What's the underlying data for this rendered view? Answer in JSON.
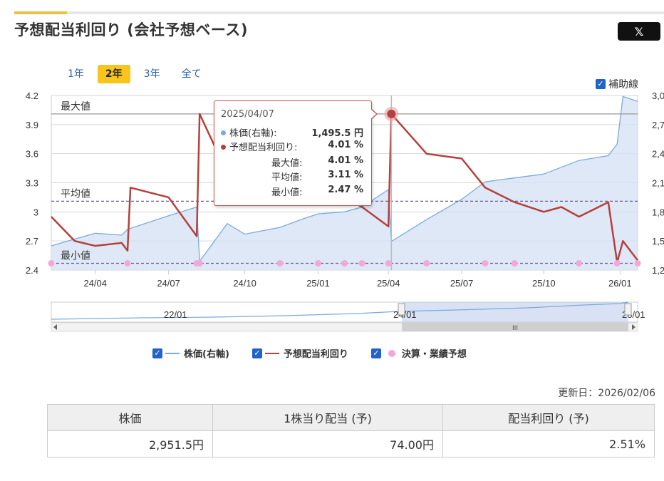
{
  "title": "予想配当利回り (会社予想ベース)",
  "share_button": {
    "label": "𝕏"
  },
  "ranges": [
    {
      "label": "1年",
      "active": false
    },
    {
      "label": "2年",
      "active": true
    },
    {
      "label": "3年",
      "active": false
    },
    {
      "label": "全て",
      "active": false
    }
  ],
  "aux_line": {
    "label": "補助線",
    "checked": true
  },
  "tooltip": {
    "date": "2025/04/07",
    "rows": [
      {
        "label": "株価(右軸):",
        "value": "1,495.5 円"
      },
      {
        "label": "予想配当利回り:",
        "value": "4.01 %"
      },
      {
        "label": "最大値:",
        "value": "4.01 %"
      },
      {
        "label": "平均値:",
        "value": "3.11 %"
      },
      {
        "label": "最小値:",
        "value": "2.47 %"
      }
    ]
  },
  "ref_labels": {
    "max": "最大値",
    "avg": "平均値",
    "min": "最小値"
  },
  "navigator": {
    "labels": [
      "22/01",
      "24/01",
      "26/01"
    ],
    "scroll_grip": "III"
  },
  "legend": [
    {
      "label": "株価(右軸)",
      "color": "#7aaadd",
      "kind": "line"
    },
    {
      "label": "予想配当利回り",
      "color": "#b5403d",
      "kind": "line"
    },
    {
      "label": "決算・業績予想",
      "color": "#f4a7d8",
      "kind": "dot"
    }
  ],
  "updated": "更新日：2026/02/06",
  "summary": {
    "headers": [
      "株価",
      "1株当り配当 (予)",
      "配当利回り (予)"
    ],
    "values": [
      "2,951.5円",
      "74.00円",
      "2.51%"
    ]
  },
  "colors": {
    "yield": "#b5403d",
    "price": "#7aaadd",
    "price_fill": "#d3e0f3",
    "event": "#f4a7d8",
    "accent": "#f7c51c"
  },
  "chart_data": {
    "type": "line",
    "x_tick_labels": [
      "24/04",
      "24/07",
      "24/10",
      "25/01",
      "25/04",
      "25/07",
      "25/10",
      "26/01"
    ],
    "y_left": {
      "ticks": [
        "4.2",
        "3.9",
        "3.6",
        "3.3",
        "3",
        "2.7",
        "2.4"
      ],
      "ylim": [
        2.4,
        4.2
      ]
    },
    "y_right": {
      "ticks": [
        "3,000",
        "2,700",
        "2,400",
        "2,100",
        "1,800",
        "1,500",
        "1,200"
      ],
      "ylim": [
        1200,
        3000
      ]
    },
    "reference_lines": {
      "max": 4.01,
      "avg": 3.11,
      "min": 2.47
    },
    "series": [
      {
        "name": "予想配当利回り",
        "axis": "left",
        "x": [
          "24/02",
          "24/03",
          "24/04",
          "24/05",
          "24/06",
          "24/06b",
          "24/07",
          "24/08",
          "24/08b",
          "24/09",
          "24/10",
          "24/11",
          "24/12",
          "25/01",
          "25/02",
          "25/03",
          "25/04",
          "25/04b",
          "25/05",
          "25/06",
          "25/07",
          "25/08",
          "25/09",
          "25/10",
          "25/11",
          "25/12",
          "26/01",
          "26/01b",
          "26/02"
        ],
        "values": [
          2.95,
          2.7,
          2.65,
          2.68,
          2.6,
          3.25,
          3.15,
          2.75,
          4.01,
          3.4,
          3.5,
          3.3,
          3.25,
          3.2,
          3.15,
          3.05,
          2.85,
          4.01,
          3.6,
          3.55,
          3.25,
          3.1,
          3.0,
          3.05,
          2.95,
          3.1,
          2.48,
          2.7,
          2.5
        ]
      },
      {
        "name": "株価(右軸)",
        "axis": "right",
        "x": [
          "24/02",
          "24/03",
          "24/04",
          "24/05",
          "24/06",
          "24/07",
          "24/08",
          "24/08b",
          "24/09",
          "24/10",
          "24/11",
          "24/12",
          "25/01",
          "25/02",
          "25/03",
          "25/04",
          "25/04b",
          "25/05",
          "25/06",
          "25/07",
          "25/08",
          "25/09",
          "25/10",
          "25/11",
          "25/12",
          "26/01",
          "26/01b",
          "26/02"
        ],
        "values": [
          1450,
          1520,
          1580,
          1560,
          1620,
          1760,
          1850,
          1290,
          1680,
          1570,
          1640,
          1730,
          1780,
          1800,
          1850,
          2030,
          1495,
          1720,
          1930,
          2110,
          2150,
          2190,
          2260,
          2330,
          2380,
          2500,
          2990,
          2940
        ]
      }
    ],
    "events_x": [
      "24/02",
      "24/06",
      "24/08",
      "24/08b",
      "24/11",
      "25/01",
      "25/02",
      "25/03",
      "25/04",
      "25/05",
      "25/07",
      "25/08",
      "25/11",
      "26/01",
      "26/02"
    ]
  }
}
